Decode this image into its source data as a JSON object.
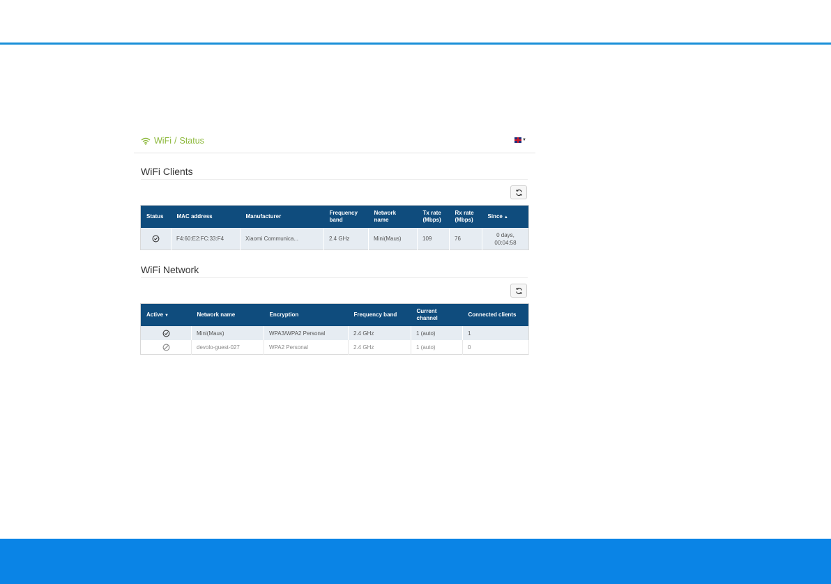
{
  "breadcrumb": {
    "section": "WiFi",
    "separator": "/",
    "page": "Status"
  },
  "language": {
    "flag": "uk-flag-icon"
  },
  "clients": {
    "title": "WiFi Clients",
    "columns": [
      "Status",
      "MAC address",
      "Manufacturer",
      "Frequency band",
      "Network name",
      "Tx rate (Mbps)",
      "Rx rate (Mbps)",
      "Since"
    ],
    "rows": [
      {
        "status": "check-circle-icon",
        "mac": "F4:60:E2:FC:33:F4",
        "manufacturer": "Xiaomi Communica...",
        "band": "2.4 GHz",
        "network": "Mini(Maus)",
        "tx": "109",
        "rx": "76",
        "since_line1": "0 days,",
        "since_line2": "00:04:58"
      }
    ]
  },
  "network": {
    "title": "WiFi Network",
    "columns": [
      "Active",
      "Network name",
      "Encryption",
      "Frequency band",
      "Current channel",
      "Connected clients"
    ],
    "rows": [
      {
        "active": "check-circle-icon",
        "name": "Mini(Maus)",
        "encryption": "WPA3/WPA2 Personal",
        "band": "2.4 GHz",
        "channel": "1 (auto)",
        "clients": "1"
      },
      {
        "active": "disabled-circle-icon",
        "name": "devolo-guest-027",
        "encryption": "WPA2 Personal",
        "band": "2.4 GHz",
        "channel": "1 (auto)",
        "clients": "0"
      }
    ]
  },
  "colors": {
    "accent_rule": "#1a8fd8",
    "footer": "#0a84e6",
    "table_header": "#0f4c7d",
    "breadcrumb": "#8cb83a"
  }
}
